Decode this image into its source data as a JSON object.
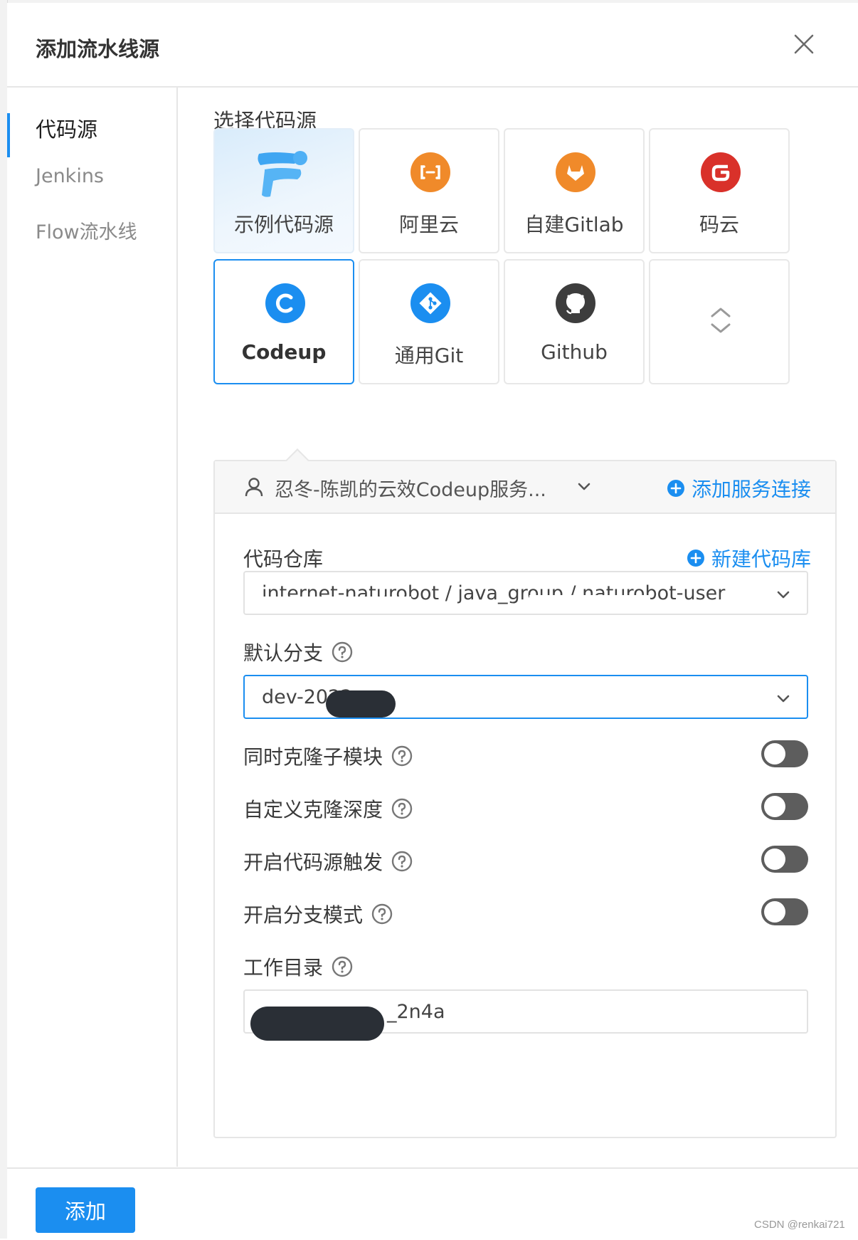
{
  "dialog": {
    "title": "添加流水线源"
  },
  "sidebar": {
    "items": [
      {
        "label": "代码源",
        "active": true
      },
      {
        "label": "Jenkins",
        "active": false
      },
      {
        "label": "Flow流水线",
        "active": false
      }
    ]
  },
  "source_picker": {
    "label": "选择代码源",
    "cards": [
      {
        "label": "示例代码源",
        "icon": "flow-logo-icon",
        "selected": false
      },
      {
        "label": "阿里云",
        "icon": "aliyun-icon",
        "color": "#f08a2a",
        "selected": false
      },
      {
        "label": "自建Gitlab",
        "icon": "gitlab-icon",
        "color": "#f08a2a",
        "selected": false
      },
      {
        "label": "码云",
        "icon": "gitee-icon",
        "color": "#d9312a",
        "selected": false
      },
      {
        "label": "Codeup",
        "icon": "codeup-icon",
        "color": "#1b8ef0",
        "selected": true
      },
      {
        "label": "通用Git",
        "icon": "git-icon",
        "color": "#1b8ef0",
        "selected": false
      },
      {
        "label": "Github",
        "icon": "github-icon",
        "color": "#3d3d3d",
        "selected": false
      },
      {
        "label": "",
        "icon": "expand-collapse-icon",
        "selected": false
      }
    ]
  },
  "service": {
    "name": "忍冬-陈凯的云效Codeup服务...",
    "add_connection": "添加服务连接"
  },
  "form": {
    "repo": {
      "label": "代码仓库",
      "new_repo": "新建代码库",
      "value": "internet-naturobot / java_group / naturobot-user"
    },
    "branch": {
      "label": "默认分支",
      "value": "dev-2022"
    },
    "toggles": [
      {
        "label": "同时克隆子模块",
        "on": false
      },
      {
        "label": "自定义克隆深度",
        "on": false
      },
      {
        "label": "开启代码源触发",
        "on": false
      },
      {
        "label": "开启分支模式",
        "on": false
      }
    ],
    "workdir": {
      "label": "工作目录",
      "value": "_2n4a"
    }
  },
  "footer": {
    "add_button": "添加"
  },
  "watermark": "CSDN @renkai721",
  "colors": {
    "accent": "#1b8ef0",
    "toggle_off": "#5d5d5d"
  }
}
